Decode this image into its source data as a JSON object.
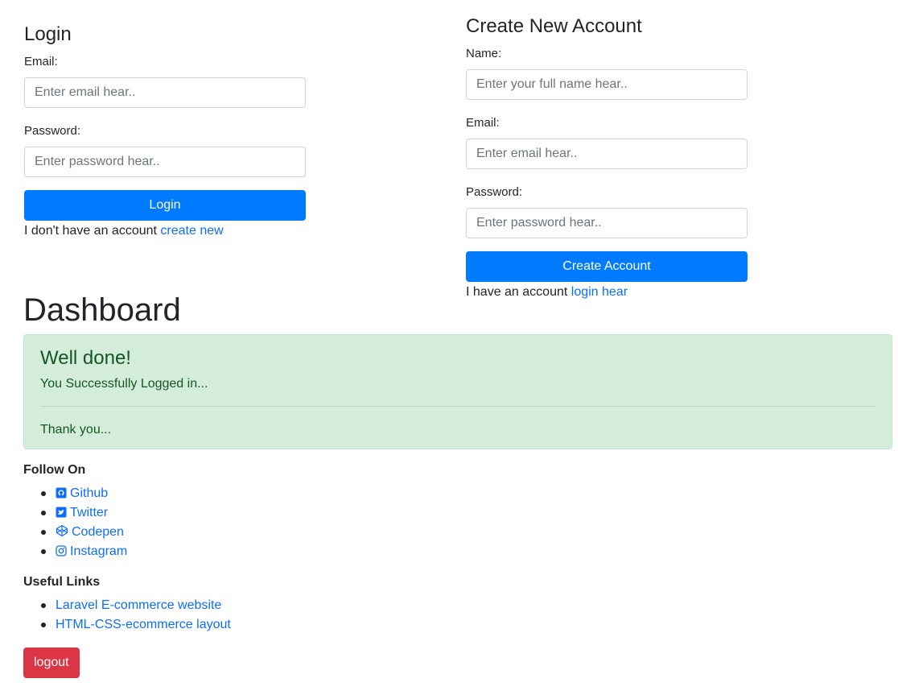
{
  "login": {
    "title": "Login",
    "email_label": "Email:",
    "email_placeholder": "Enter email hear..",
    "password_label": "Password:",
    "password_placeholder": "Enter password hear..",
    "button": "Login",
    "note": "I don't have an account",
    "note_link": "create new"
  },
  "register": {
    "title": "Create New Account",
    "name_label": "Name:",
    "name_placeholder": "Enter your full name hear..",
    "email_label": "Email:",
    "email_placeholder": "Enter email hear..",
    "password_label": "Password:",
    "password_placeholder": "Enter password hear..",
    "button": "Create Account",
    "note": "I have an account",
    "note_link": "login hear"
  },
  "dashboard": {
    "title": "Dashboard",
    "alert": {
      "heading": "Well done!",
      "message": "You Successfully Logged in...",
      "footer": "Thank you..."
    },
    "follow": {
      "title": "Follow On",
      "items": [
        {
          "label": "Github",
          "icon": "github-icon"
        },
        {
          "label": "Twitter",
          "icon": "twitter-icon"
        },
        {
          "label": "Codepen",
          "icon": "codepen-icon"
        },
        {
          "label": "Instagram",
          "icon": "instagram-icon"
        }
      ]
    },
    "useful": {
      "title": "Useful Links",
      "items": [
        {
          "label": "Laravel E-commerce website"
        },
        {
          "label": "HTML-CSS-ecommerce layout"
        }
      ]
    },
    "logout": "logout"
  },
  "colors": {
    "primary": "#007bff",
    "link": "#0d6efd",
    "danger": "#dc3545",
    "success_bg": "#d4edda",
    "success_text": "#155724"
  }
}
